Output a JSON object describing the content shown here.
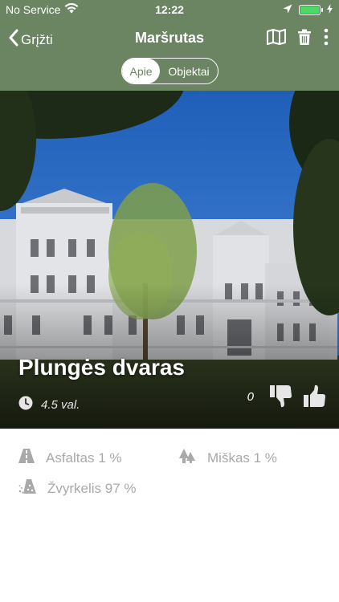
{
  "status_bar": {
    "carrier": "No Service",
    "time": "12:22",
    "icons": [
      "wifi-icon",
      "location-arrow-icon",
      "battery-icon",
      "charging-bolt-icon"
    ]
  },
  "navbar": {
    "back_label": "Grįžti",
    "title": "Maršrutas",
    "actions": [
      "map-icon",
      "trash-icon",
      "more-vertical-icon"
    ]
  },
  "segmented": {
    "tabs": [
      "Apie",
      "Objektai"
    ],
    "selected": "Apie"
  },
  "hero": {
    "title": "Plungės dvaras",
    "duration": "4.5 val.",
    "like_count": "0",
    "icons": [
      "clock-icon",
      "thumbs-down-icon",
      "thumbs-up-icon"
    ]
  },
  "surfaces": [
    {
      "icon": "road-icon",
      "text": "Asfaltas 1 %"
    },
    {
      "icon": "forest-icon",
      "text": "Miškas 1 %"
    },
    {
      "icon": "gravel-icon",
      "text": "Žvyrkelis 97 %"
    }
  ],
  "colors": {
    "header": "#6b8563",
    "text_muted": "#a9a9a9",
    "white": "#ffffff",
    "battery": "#4cd964"
  }
}
